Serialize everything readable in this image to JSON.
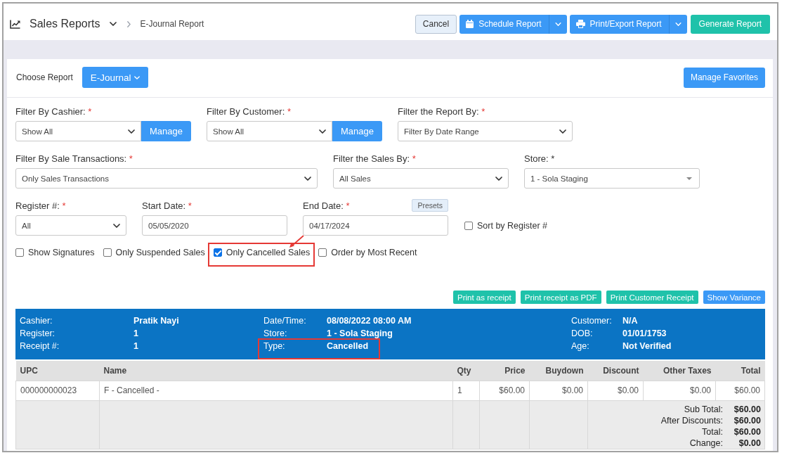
{
  "header": {
    "title": "Sales Reports",
    "breadcrumb": "E-Journal Report",
    "buttons": [
      {
        "label": "Cancel",
        "kind": "cancel"
      },
      {
        "label": "Schedule Report",
        "kind": "schedule"
      },
      {
        "label": "Print/Export Report",
        "kind": "export"
      },
      {
        "label": "Generate Report",
        "kind": "generate"
      }
    ]
  },
  "report_picker": {
    "label": "Choose Report",
    "value": "E-Journal",
    "favorites_button": "Manage Favorites"
  },
  "filter_rows": [
    [
      {
        "kind": "select",
        "label": "Filter By Cashier:",
        "mark": "*",
        "required": true,
        "value": "Show All",
        "button": "Manage"
      },
      {
        "kind": "select",
        "label": "Filter By Customer:",
        "mark": "*",
        "required": true,
        "value": "Show All",
        "button": "Manage"
      },
      {
        "kind": "select",
        "label": "Filter the Report By:",
        "mark": "*",
        "required": true,
        "value": "Filter By Date Range"
      }
    ],
    [
      {
        "kind": "select",
        "label": "Filter By Sale Transactions:",
        "mark": "*",
        "required": true,
        "value": "Only Sales Transactions"
      },
      {
        "kind": "select",
        "label": "Filter the Sales By:",
        "mark": "*",
        "required": true,
        "value": "All Sales"
      },
      {
        "kind": "combobox",
        "label": "Store:",
        "mark": "*",
        "required": false,
        "value": "1 - Sola Staging"
      }
    ],
    [
      {
        "kind": "select",
        "label": "Register #:",
        "mark": "*",
        "required": true,
        "value": "All"
      },
      {
        "kind": "date",
        "label": "Start Date:",
        "mark": "*",
        "required": true,
        "value": "05/05/2020"
      },
      {
        "kind": "date",
        "label": "End Date:",
        "mark": "*",
        "required": true,
        "value": "04/17/2024",
        "button": "Presets"
      },
      {
        "kind": "checkbox",
        "label": "Sort by Register #",
        "checked": false,
        "highlighted": false,
        "arrow": false
      }
    ]
  ],
  "options": [
    {
      "label": "Show Signatures",
      "checked": false,
      "highlighted": false,
      "arrow": false
    },
    {
      "label": "Only Suspended Sales",
      "checked": false,
      "highlighted": false,
      "arrow": false
    },
    {
      "label": "Only Cancelled Sales",
      "checked": true,
      "highlighted": true,
      "arrow": true
    },
    {
      "label": "Order by Most Recent",
      "checked": false,
      "highlighted": false,
      "arrow": false
    }
  ],
  "print_buttons": [
    {
      "label": "Print as receipt",
      "kind": "print"
    },
    {
      "label": "Print receipt as PDF",
      "kind": "print"
    },
    {
      "label": "Print Customer Receipt",
      "kind": "print"
    },
    {
      "label": "Show Variance",
      "kind": "variance"
    }
  ],
  "receipt": {
    "info_groups": [
      [
        {
          "label": "Cashier:",
          "value": "Pratik Nayi",
          "highlighted": false
        },
        {
          "label": "Register:",
          "value": "1",
          "highlighted": false
        },
        {
          "label": "Receipt #:",
          "value": "1",
          "highlighted": false
        }
      ],
      [
        {
          "label": "Date/Time:",
          "value": "08/08/2022 08:00 AM",
          "highlighted": false
        },
        {
          "label": "Store:",
          "value": "1 - Sola Staging",
          "highlighted": false
        },
        {
          "label": "Type:",
          "value": "Cancelled",
          "highlighted": true
        }
      ],
      [
        {
          "label": "Customer:",
          "value": "N/A",
          "highlighted": false
        },
        {
          "label": "DOB:",
          "value": "01/01/1753",
          "highlighted": false
        },
        {
          "label": "Age:",
          "value": "Not Verified",
          "highlighted": false
        }
      ]
    ],
    "table": {
      "columns": [
        "UPC",
        "Name",
        "Qty",
        "Price",
        "Buydown",
        "Discount",
        "Other Taxes",
        "Total"
      ],
      "rows": [
        [
          "000000000023",
          "F - Cancelled -",
          "1",
          "$60.00",
          "$0.00",
          "$0.00",
          "$0.00",
          "$60.00"
        ]
      ],
      "totals": [
        {
          "label": "Sub Total:",
          "value": "$60.00"
        },
        {
          "label": "After Discounts:",
          "value": "$60.00"
        },
        {
          "label": "Total:",
          "value": "$60.00"
        },
        {
          "label": "Change:",
          "value": "$0.00"
        }
      ]
    }
  }
}
